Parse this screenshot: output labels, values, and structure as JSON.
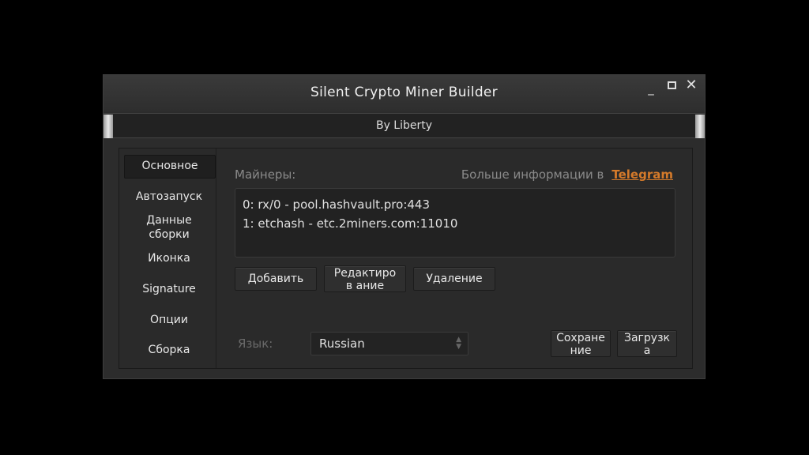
{
  "window": {
    "title": "Silent Crypto Miner Builder",
    "subtitle": "By Liberty",
    "controls": {
      "minimize": "_",
      "close": "✕"
    }
  },
  "sidebar": {
    "items": [
      {
        "label": "Основное",
        "active": true
      },
      {
        "label": "Автозапуск"
      },
      {
        "label": "Данные сборки"
      },
      {
        "label": "Иконка"
      },
      {
        "label": "Signature"
      },
      {
        "label": "Опции"
      },
      {
        "label": "Сборка"
      }
    ]
  },
  "main": {
    "miners_label": "Майнеры:",
    "more_info_text": "Больше информации в",
    "telegram_link": "Telegram",
    "miners": [
      "0: rx/0 - pool.hashvault.pro:443",
      "1: etchash - etc.2miners.com:11010"
    ],
    "buttons": {
      "add": "Добавить",
      "edit": "Редактиров ание",
      "delete": "Удаление",
      "save": "Сохране ние",
      "load": "Загрузк а"
    },
    "language_label": "Язык:",
    "language_value": "Russian"
  },
  "colors": {
    "background": "#000000",
    "window": "#2c2c2c",
    "accent_link": "#d47a2a",
    "muted_text": "#8a8a8a"
  }
}
